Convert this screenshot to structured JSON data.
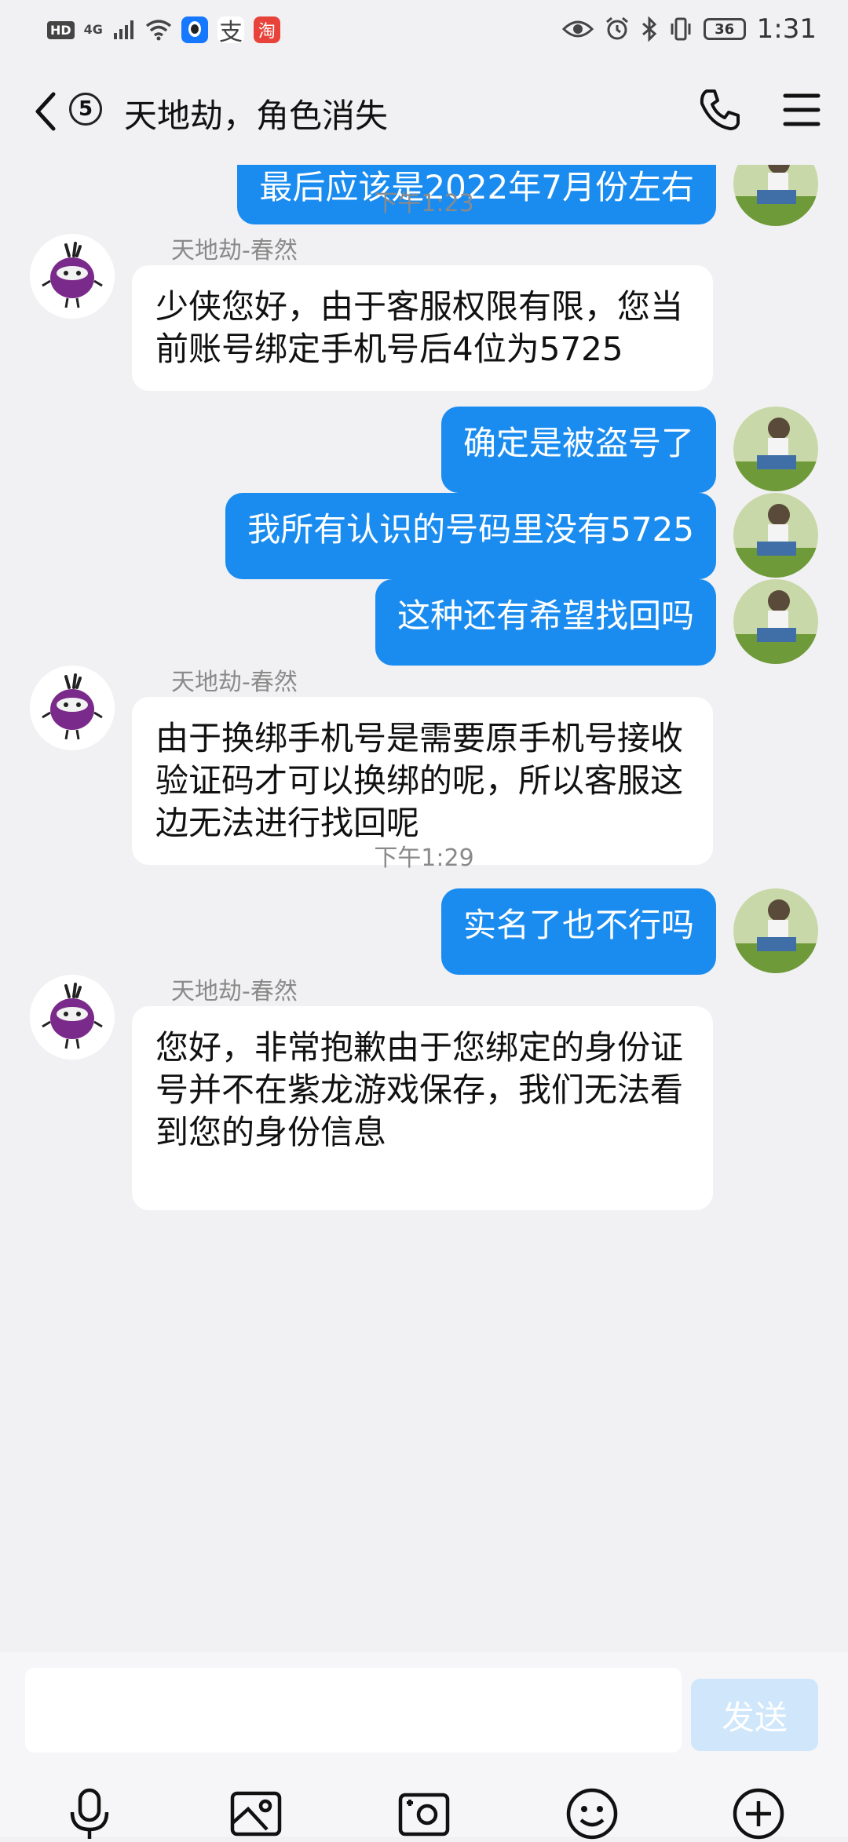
{
  "status_bar": {
    "hd": "HD",
    "network": "4G",
    "app_alipay": "支",
    "app_taobao": "淘",
    "battery": "36",
    "time": "1:31"
  },
  "header": {
    "unread_count": "5",
    "title": "天地劫，角色消失"
  },
  "messages": {
    "m0": {
      "text": "最后应该是2022年7月份左右"
    },
    "t1": "下午1:23",
    "m1": {
      "sender": "天地劫-春然",
      "text": "少侠您好，由于客服权限有限，您当前账号绑定手机号后4位为5725"
    },
    "m2": {
      "text": "确定是被盗号了"
    },
    "m3": {
      "text": "我所有认识的号码里没有5725"
    },
    "m4": {
      "text": "这种还有希望找回吗"
    },
    "m5": {
      "sender": "天地劫-春然",
      "text": "由于换绑手机号是需要原手机号接收验证码才可以换绑的呢，所以客服这边无法进行找回呢"
    },
    "t2": "下午1:29",
    "m6": {
      "text": "实名了也不行吗"
    },
    "m7": {
      "sender": "天地劫-春然",
      "text": "您好，非常抱歉由于您绑定的身份证号并不在紫龙游戏保存，我们无法看到您的身份信息"
    }
  },
  "input": {
    "value": "",
    "send_label": "发送"
  },
  "colors": {
    "outgoing_bubble": "#1a8cf0",
    "incoming_bubble": "#ffffff",
    "background": "#f1f1f3",
    "send_disabled": "#cfe6fb"
  },
  "icons": {
    "back": "chevron-left-icon",
    "call": "phone-icon",
    "menu": "hamburger-menu-icon",
    "voice": "microphone-icon",
    "image": "image-icon",
    "camera": "camera-icon",
    "emoji": "smiley-icon",
    "more": "plus-circle-icon"
  }
}
